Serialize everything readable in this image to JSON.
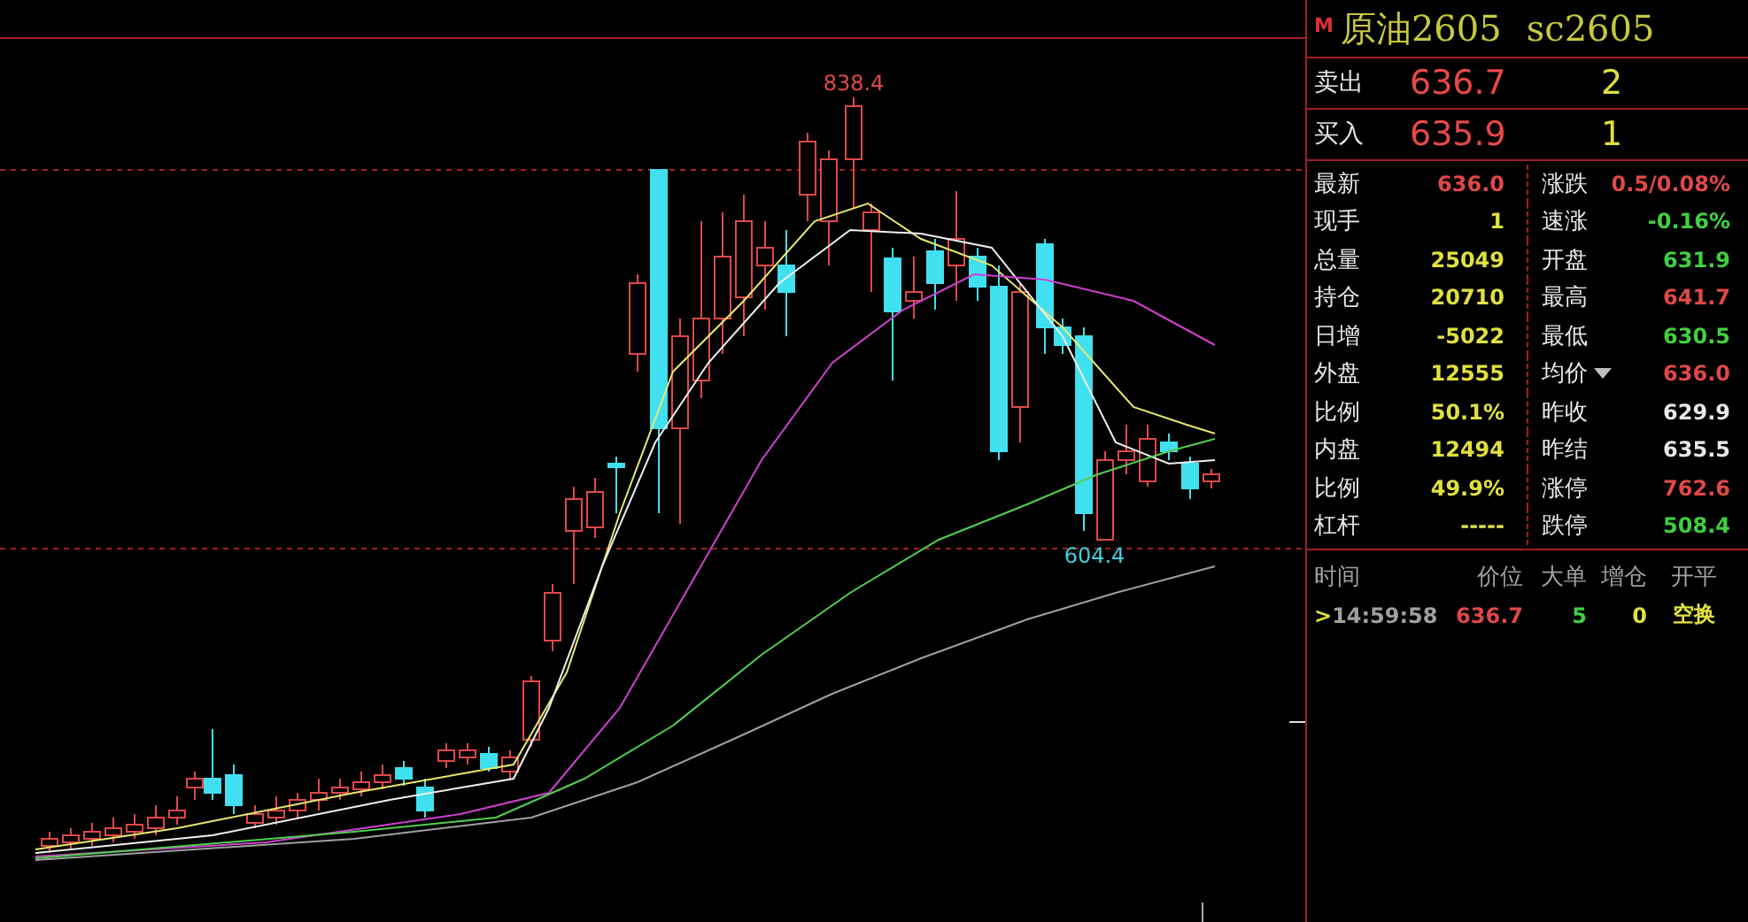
{
  "chart": {
    "high_label": "838.4",
    "low_label": "604.4"
  },
  "quote_panel": {
    "badge": "M",
    "title": "原油2605",
    "code": "sc2605",
    "book": [
      {
        "label": "卖出",
        "price": "636.7",
        "volume": "2"
      },
      {
        "label": "买入",
        "price": "635.9",
        "volume": "1"
      }
    ],
    "stats": [
      {
        "label": "最新",
        "value": "636.0",
        "color": "#e04848",
        "kind": "plain"
      },
      {
        "label": "涨跌",
        "value": "0.5/0.08%",
        "color": "#e04848",
        "kind": "plain"
      },
      {
        "label": "现手",
        "value": "1",
        "color": "#e0e040",
        "kind": "plain"
      },
      {
        "label": "速涨",
        "value": "-0.16%",
        "color": "#40d040",
        "kind": "plain"
      },
      {
        "label": "总量",
        "value": "25049",
        "color": "#e0e040",
        "kind": "plain"
      },
      {
        "label": "开盘",
        "value": "631.9",
        "color": "#40d040",
        "kind": "plain"
      },
      {
        "label": "持仓",
        "value": "20710",
        "color": "#e0e040",
        "kind": "plain"
      },
      {
        "label": "最高",
        "value": "641.7",
        "color": "#e04848",
        "kind": "plain"
      },
      {
        "label": "日增",
        "value": "-5022",
        "color": "#e0e040",
        "kind": "plain"
      },
      {
        "label": "最低",
        "value": "630.5",
        "color": "#40d040",
        "kind": "plain"
      },
      {
        "label": "外盘",
        "value": "12555",
        "color": "#e0e040",
        "kind": "plain"
      },
      {
        "label": "均价",
        "value": "636.0",
        "color": "#e04848",
        "kind": "menu"
      },
      {
        "label": "比例",
        "value": "50.1%",
        "color": "#e0e040",
        "kind": "plain"
      },
      {
        "label": "昨收",
        "value": "629.9",
        "color": "#e8e8e8",
        "kind": "plain"
      },
      {
        "label": "内盘",
        "value": "12494",
        "color": "#e0e040",
        "kind": "plain"
      },
      {
        "label": "昨结",
        "value": "635.5",
        "color": "#e8e8e8",
        "kind": "plain"
      },
      {
        "label": "比例",
        "value": "49.9%",
        "color": "#e0e040",
        "kind": "plain"
      },
      {
        "label": "涨停",
        "value": "762.6",
        "color": "#e04848",
        "kind": "plain"
      },
      {
        "label": "杠杆",
        "value": "-----",
        "color": "#e0e040",
        "kind": "plain"
      },
      {
        "label": "跌停",
        "value": "508.4",
        "color": "#40d040",
        "kind": "plain"
      }
    ],
    "trades": {
      "columns": [
        "时间",
        "价位",
        "大单",
        "增仓",
        "开平"
      ],
      "rows": [
        {
          "marker": ">",
          "time": "14:59:58",
          "price": "636.7",
          "big": "5",
          "change": "0",
          "action": "空换"
        }
      ]
    }
  }
}
